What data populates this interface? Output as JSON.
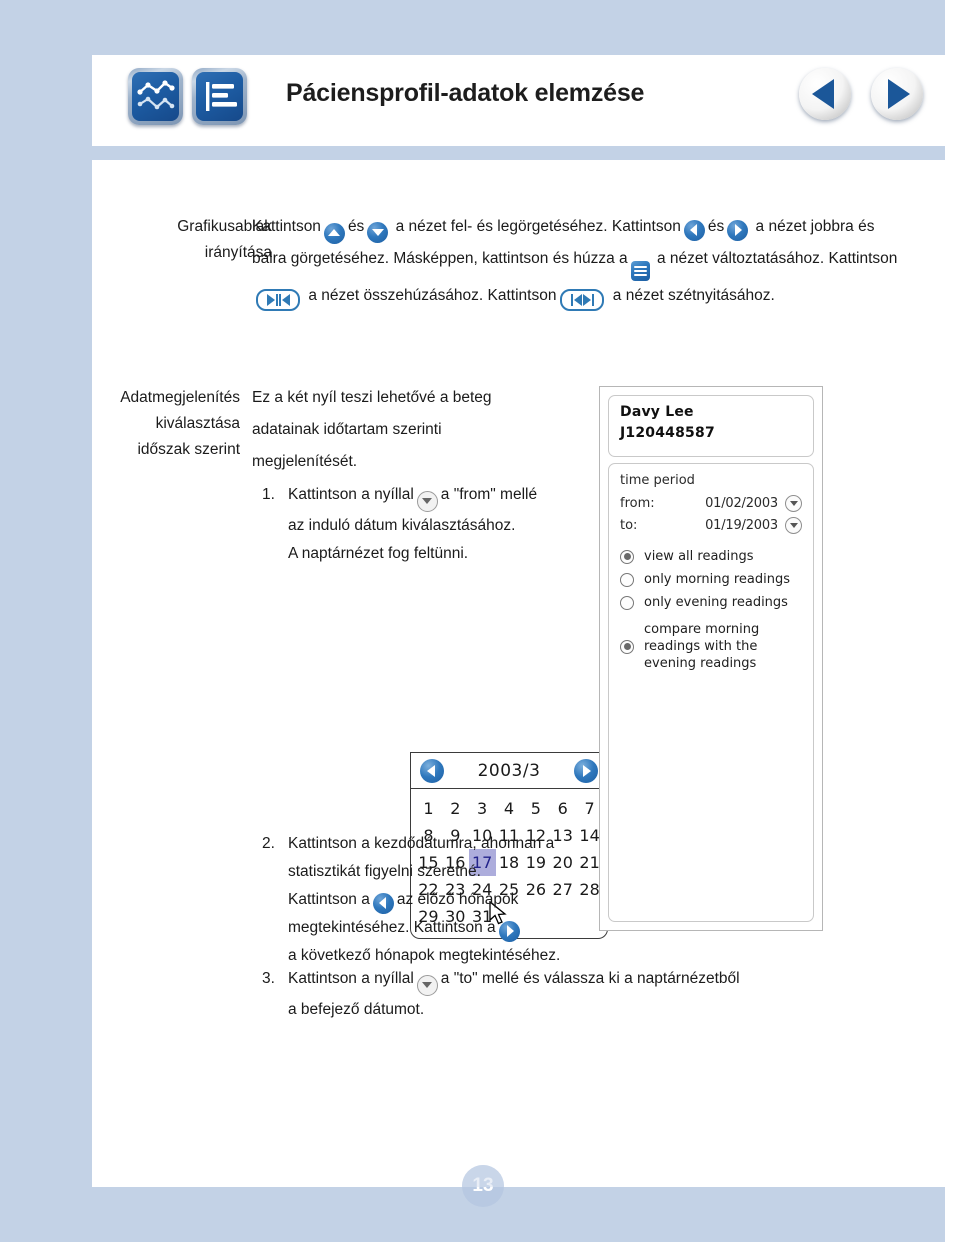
{
  "header": {
    "title": "Páciensprofil-adatok elemzése",
    "icons": [
      "graph-chart-icon",
      "bar-list-icon"
    ],
    "nav": {
      "prev": "previous-page-button",
      "next": "next-page-button"
    }
  },
  "sections": [
    {
      "label_lines": [
        "Grafikusablak",
        "irányítása"
      ],
      "lines": [
        "Kattintson",
        "és",
        "a nézet fel- és legörgetéséhez. Kattintson",
        "és",
        "a nézet jobbra és balra görgetéséhez. Másképpen, kattintson és húzza a",
        "a nézet változtatásához.",
        "Kattintson",
        "a nézet összehúzásához. Kattintson",
        "a nézet szétnyitásához."
      ]
    },
    {
      "label_lines": [
        "Adatmegjelenítés",
        "kiválasztása",
        "időszak szerint"
      ],
      "intro_lines": [
        "Ez a két nyíl teszi lehetővé a beteg",
        "adatainak időtartam szerinti",
        "megjelenítését."
      ]
    }
  ],
  "steps": [
    {
      "num": "1.",
      "pre": "Kattintson a nyíllal",
      "post": "a \"from\" mellé",
      "extra_lines": [
        "az induló dátum kiválasztásához.",
        "A naptárnézet fog feltünni."
      ]
    },
    {
      "num": "2.",
      "l1": "Kattintson a kezdődátumra, ahonnan a",
      "l2": "statisztikát figyelni szeretné.",
      "l3a": "Kattintson a",
      "l3b": "az előző hónapok",
      "l4a": "megtekintéséhez. Kattintson a",
      "l5": "a következő hónapok megtekintéséhez."
    },
    {
      "num": "3.",
      "pre": "Kattintson a nyíllal",
      "post": "a \"to\" mellé és válassza ki a naptárnézetből",
      "extra_lines": [
        "a befejező dátumot."
      ]
    }
  ],
  "calendar": {
    "title": "2003/3",
    "prev_icon": "calendar-prev-month-icon",
    "next_icon": "calendar-next-month-icon",
    "selected_day": "17",
    "weeks": [
      [
        "1",
        "2",
        "3",
        "4",
        "5",
        "6",
        "7"
      ],
      [
        "8",
        "9",
        "10",
        "11",
        "12",
        "13",
        "14"
      ],
      [
        "15",
        "16",
        "17",
        "18",
        "19",
        "20",
        "21"
      ],
      [
        "22",
        "23",
        "24",
        "25",
        "26",
        "27",
        "28"
      ],
      [
        "29",
        "30",
        "31",
        "",
        "",
        "",
        ""
      ]
    ]
  },
  "device": {
    "patient": {
      "name": "Davy Lee",
      "id": "J120448587"
    },
    "time_period": {
      "title": "time period",
      "from_label": "from:",
      "from_value": "01/02/2003",
      "to_label": "to:",
      "to_value": "01/19/2003"
    },
    "radios": [
      {
        "label": "view all readings",
        "selected": true
      },
      {
        "label": "only morning readings",
        "selected": false
      },
      {
        "label": "only evening readings",
        "selected": false
      },
      {
        "label": "compare morning readings with the evening readings",
        "selected": true
      }
    ]
  },
  "footer": {
    "page_number": "13"
  },
  "colors": {
    "background": "#c3d2e6",
    "accent_blue": "#1d5fa3",
    "selection": "#adaddc"
  }
}
